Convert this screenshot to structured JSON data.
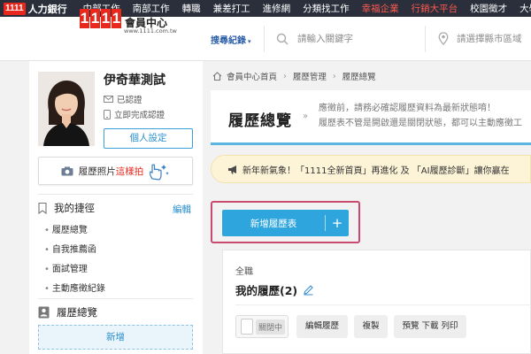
{
  "topnav": {
    "logo": "1111",
    "brand": "人力銀行",
    "items": [
      {
        "label": "中部工作",
        "red": false
      },
      {
        "label": "南部工作",
        "red": false
      },
      {
        "label": "轉職",
        "red": false
      },
      {
        "label": "兼差打工",
        "red": false
      },
      {
        "label": "進修網",
        "red": false
      },
      {
        "label": "分類找工作",
        "red": false
      },
      {
        "label": "幸福企業",
        "red": true
      },
      {
        "label": "行銷大平台",
        "red": true
      },
      {
        "label": "校園徵才",
        "red": false
      },
      {
        "label": "大學網",
        "red": false
      }
    ]
  },
  "header": {
    "logo_digits": [
      "1",
      "1",
      "1",
      "1"
    ],
    "logo_center": "會員中心",
    "logo_url": "www.1111.com.tw",
    "search_history": "搜尋紀錄",
    "keyword_placeholder": "請輸入關鍵字",
    "location_placeholder": "請選擇縣市區域"
  },
  "sidebar": {
    "user_name": "伊奇華測試",
    "verified": "已認證",
    "unverified": "立即完成認證",
    "personal_settings": "個人設定",
    "photo_btn_prefix": "履歷照片",
    "photo_btn_red": "這樣拍",
    "shortcuts_title": "我的捷徑",
    "edit": "編輯",
    "menu": [
      "履歷總覽",
      "自我推薦函",
      "面試管理",
      "主動應徵紀錄"
    ],
    "overview_title": "履歷總覽",
    "add_btn": "新增"
  },
  "breadcrumb": [
    "會員中心首頁",
    "履歷管理",
    "履歷總覽"
  ],
  "resume_header": {
    "title": "履歷總覽",
    "desc1": "應徵前，請務必確認履歷資料為最新狀態唷！",
    "desc2": "履歷表不管是開啟還是關閉狀態，都可以主動應徵工"
  },
  "notice": "新年新氣象！「1111全新首頁」再進化 及 「AI履歷診斷」讓你贏在",
  "new_resume_btn": "新增履歷表",
  "resume_item": {
    "job_type": "全職",
    "name": "我的履歷(2)",
    "toggle_label": "關閉中",
    "actions": [
      "編輯履歷",
      "複製",
      "預覽 下載 列印"
    ]
  },
  "colors": {
    "topnav_bg": "#2a2f3b",
    "brand_red": "#e8271d",
    "accent_blue": "#2fa5de",
    "highlight_frame": "#c84a6e",
    "notice_bg": "#fdf4d8"
  }
}
